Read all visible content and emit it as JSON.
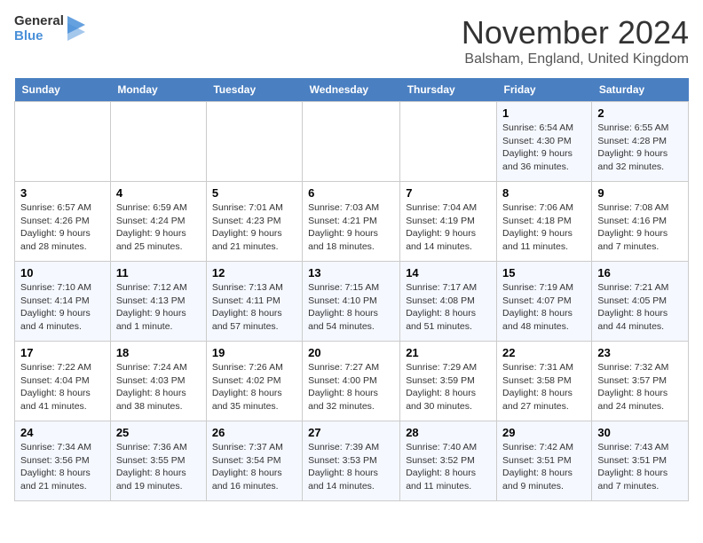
{
  "logo": {
    "line1": "General",
    "line2": "Blue"
  },
  "title": "November 2024",
  "subtitle": "Balsham, England, United Kingdom",
  "days_of_week": [
    "Sunday",
    "Monday",
    "Tuesday",
    "Wednesday",
    "Thursday",
    "Friday",
    "Saturday"
  ],
  "weeks": [
    [
      {
        "day": "",
        "info": ""
      },
      {
        "day": "",
        "info": ""
      },
      {
        "day": "",
        "info": ""
      },
      {
        "day": "",
        "info": ""
      },
      {
        "day": "",
        "info": ""
      },
      {
        "day": "1",
        "info": "Sunrise: 6:54 AM\nSunset: 4:30 PM\nDaylight: 9 hours and 36 minutes."
      },
      {
        "day": "2",
        "info": "Sunrise: 6:55 AM\nSunset: 4:28 PM\nDaylight: 9 hours and 32 minutes."
      }
    ],
    [
      {
        "day": "3",
        "info": "Sunrise: 6:57 AM\nSunset: 4:26 PM\nDaylight: 9 hours and 28 minutes."
      },
      {
        "day": "4",
        "info": "Sunrise: 6:59 AM\nSunset: 4:24 PM\nDaylight: 9 hours and 25 minutes."
      },
      {
        "day": "5",
        "info": "Sunrise: 7:01 AM\nSunset: 4:23 PM\nDaylight: 9 hours and 21 minutes."
      },
      {
        "day": "6",
        "info": "Sunrise: 7:03 AM\nSunset: 4:21 PM\nDaylight: 9 hours and 18 minutes."
      },
      {
        "day": "7",
        "info": "Sunrise: 7:04 AM\nSunset: 4:19 PM\nDaylight: 9 hours and 14 minutes."
      },
      {
        "day": "8",
        "info": "Sunrise: 7:06 AM\nSunset: 4:18 PM\nDaylight: 9 hours and 11 minutes."
      },
      {
        "day": "9",
        "info": "Sunrise: 7:08 AM\nSunset: 4:16 PM\nDaylight: 9 hours and 7 minutes."
      }
    ],
    [
      {
        "day": "10",
        "info": "Sunrise: 7:10 AM\nSunset: 4:14 PM\nDaylight: 9 hours and 4 minutes."
      },
      {
        "day": "11",
        "info": "Sunrise: 7:12 AM\nSunset: 4:13 PM\nDaylight: 9 hours and 1 minute."
      },
      {
        "day": "12",
        "info": "Sunrise: 7:13 AM\nSunset: 4:11 PM\nDaylight: 8 hours and 57 minutes."
      },
      {
        "day": "13",
        "info": "Sunrise: 7:15 AM\nSunset: 4:10 PM\nDaylight: 8 hours and 54 minutes."
      },
      {
        "day": "14",
        "info": "Sunrise: 7:17 AM\nSunset: 4:08 PM\nDaylight: 8 hours and 51 minutes."
      },
      {
        "day": "15",
        "info": "Sunrise: 7:19 AM\nSunset: 4:07 PM\nDaylight: 8 hours and 48 minutes."
      },
      {
        "day": "16",
        "info": "Sunrise: 7:21 AM\nSunset: 4:05 PM\nDaylight: 8 hours and 44 minutes."
      }
    ],
    [
      {
        "day": "17",
        "info": "Sunrise: 7:22 AM\nSunset: 4:04 PM\nDaylight: 8 hours and 41 minutes."
      },
      {
        "day": "18",
        "info": "Sunrise: 7:24 AM\nSunset: 4:03 PM\nDaylight: 8 hours and 38 minutes."
      },
      {
        "day": "19",
        "info": "Sunrise: 7:26 AM\nSunset: 4:02 PM\nDaylight: 8 hours and 35 minutes."
      },
      {
        "day": "20",
        "info": "Sunrise: 7:27 AM\nSunset: 4:00 PM\nDaylight: 8 hours and 32 minutes."
      },
      {
        "day": "21",
        "info": "Sunrise: 7:29 AM\nSunset: 3:59 PM\nDaylight: 8 hours and 30 minutes."
      },
      {
        "day": "22",
        "info": "Sunrise: 7:31 AM\nSunset: 3:58 PM\nDaylight: 8 hours and 27 minutes."
      },
      {
        "day": "23",
        "info": "Sunrise: 7:32 AM\nSunset: 3:57 PM\nDaylight: 8 hours and 24 minutes."
      }
    ],
    [
      {
        "day": "24",
        "info": "Sunrise: 7:34 AM\nSunset: 3:56 PM\nDaylight: 8 hours and 21 minutes."
      },
      {
        "day": "25",
        "info": "Sunrise: 7:36 AM\nSunset: 3:55 PM\nDaylight: 8 hours and 19 minutes."
      },
      {
        "day": "26",
        "info": "Sunrise: 7:37 AM\nSunset: 3:54 PM\nDaylight: 8 hours and 16 minutes."
      },
      {
        "day": "27",
        "info": "Sunrise: 7:39 AM\nSunset: 3:53 PM\nDaylight: 8 hours and 14 minutes."
      },
      {
        "day": "28",
        "info": "Sunrise: 7:40 AM\nSunset: 3:52 PM\nDaylight: 8 hours and 11 minutes."
      },
      {
        "day": "29",
        "info": "Sunrise: 7:42 AM\nSunset: 3:51 PM\nDaylight: 8 hours and 9 minutes."
      },
      {
        "day": "30",
        "info": "Sunrise: 7:43 AM\nSunset: 3:51 PM\nDaylight: 8 hours and 7 minutes."
      }
    ]
  ]
}
